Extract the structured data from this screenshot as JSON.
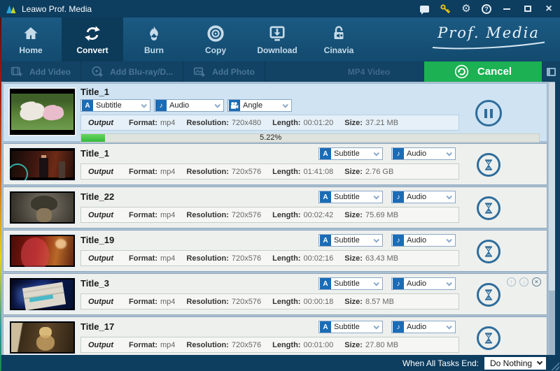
{
  "window": {
    "title": "Leawo Prof. Media",
    "titlebar_icon_names": [
      "message-icon",
      "register-key-icon",
      "settings-gear-icon",
      "help-icon",
      "minimize-icon",
      "maximize-icon",
      "close-icon"
    ]
  },
  "nav": {
    "brand": "Prof. Media",
    "items": [
      {
        "label": "Home",
        "icon": "home-icon",
        "active": false
      },
      {
        "label": "Convert",
        "icon": "convert-icon",
        "active": true
      },
      {
        "label": "Burn",
        "icon": "burn-icon",
        "active": false
      },
      {
        "label": "Copy",
        "icon": "copy-icon",
        "active": false
      },
      {
        "label": "Download",
        "icon": "download-icon",
        "active": false
      },
      {
        "label": "Cinavia",
        "icon": "cinavia-icon",
        "active": false
      }
    ]
  },
  "toolbar": {
    "add_video": "Add Video",
    "add_bluray": "Add Blu-ray/D...",
    "add_photo": "Add Photo",
    "profile": "MP4 Video",
    "cancel": "Cancel"
  },
  "labels": {
    "output": "Output",
    "format": "Format:",
    "resolution": "Resolution:",
    "length": "Length:",
    "size": "Size:"
  },
  "dropdowns": {
    "subtitle": "Subtitle",
    "audio": "Audio",
    "angle": "Angle"
  },
  "icons": {
    "subtitle_glyph": "A",
    "audio_glyph": "♪",
    "gear_glyph": "⚙",
    "help_glyph": "?",
    "close_glyph": "×",
    "up_glyph": "↑",
    "down_glyph": "↓",
    "remove_glyph": "×"
  },
  "tasks": [
    {
      "name": "Title_1",
      "format": "mp4",
      "resolution": "720x480",
      "length": "00:01:20",
      "size": "37.21 MB",
      "progress_label": "5.22%",
      "progress_width": "5.22%",
      "action_icon": "pause-icon",
      "thumbnail": "cartoon-unicorns"
    },
    {
      "name": "Title_1",
      "format": "mp4",
      "resolution": "720x576",
      "length": "01:41:08",
      "size": "2.76 GB",
      "action_icon": "hourglass-icon",
      "thumbnail": "man-in-suit"
    },
    {
      "name": "Title_22",
      "format": "mp4",
      "resolution": "720x576",
      "length": "00:02:42",
      "size": "75.69 MB",
      "action_icon": "hourglass-icon",
      "thumbnail": "soldier-helmet"
    },
    {
      "name": "Title_19",
      "format": "mp4",
      "resolution": "720x576",
      "length": "00:02:16",
      "size": "63.43 MB",
      "action_icon": "hourglass-icon",
      "thumbnail": "woman-red-veil"
    },
    {
      "name": "Title_3",
      "format": "mp4",
      "resolution": "720x576",
      "length": "00:00:18",
      "size": "8.57 MB",
      "action_icon": "hourglass-icon",
      "thumbnail": "blue-screen-dialog"
    },
    {
      "name": "Title_17",
      "format": "mp4",
      "resolution": "720x576",
      "length": "00:01:00",
      "size": "27.80 MB",
      "action_icon": "hourglass-icon",
      "thumbnail": "blonde-woman"
    }
  ],
  "footer": {
    "label": "When All Tasks End:",
    "value": "Do Nothing"
  },
  "colors": {
    "titlebar": "#0d3d5f",
    "nav_active": "#0c3b59",
    "accent_green": "#1cb152",
    "progress_green": "#35b93c",
    "selected_row": "#cfe3f2",
    "icon_blue": "#1b6cb5",
    "circle_blue": "#2e6d9c",
    "key_yellow": "#e8c414"
  }
}
